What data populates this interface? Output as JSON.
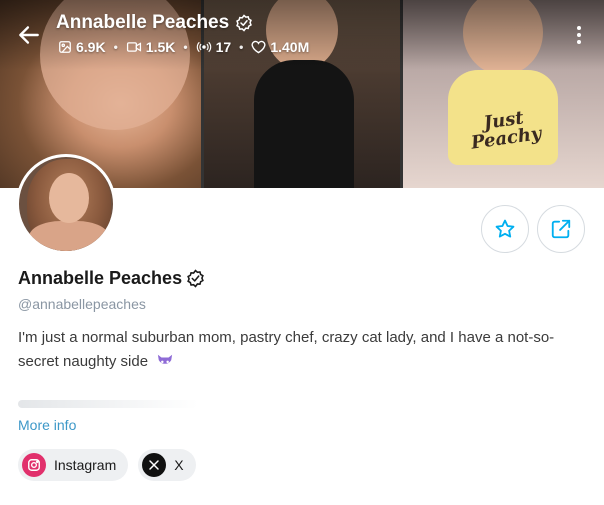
{
  "header": {
    "creator_name": "Annabelle Peaches",
    "stats": {
      "photos": "6.9K",
      "videos": "1.5K",
      "streams": "17",
      "likes": "1.40M"
    }
  },
  "cover": {
    "shirt_print": "Just Peachy"
  },
  "profile": {
    "display_name": "Annabelle Peaches",
    "handle": "@annabellepeaches",
    "bio": "I'm just a normal suburban mom, pastry chef, crazy cat lady, and I have a not-so-secret naughty side",
    "bio_emoji": "devil-emoji",
    "more_info": "More info"
  },
  "socials": [
    {
      "label": "Instagram",
      "icon": "instagram-icon",
      "color": "#e1306c"
    },
    {
      "label": "X",
      "icon": "x-icon",
      "color": "#111111"
    }
  ],
  "colors": {
    "accent": "#00aff0",
    "link": "#3d98c8",
    "muted": "#8a96a3"
  }
}
